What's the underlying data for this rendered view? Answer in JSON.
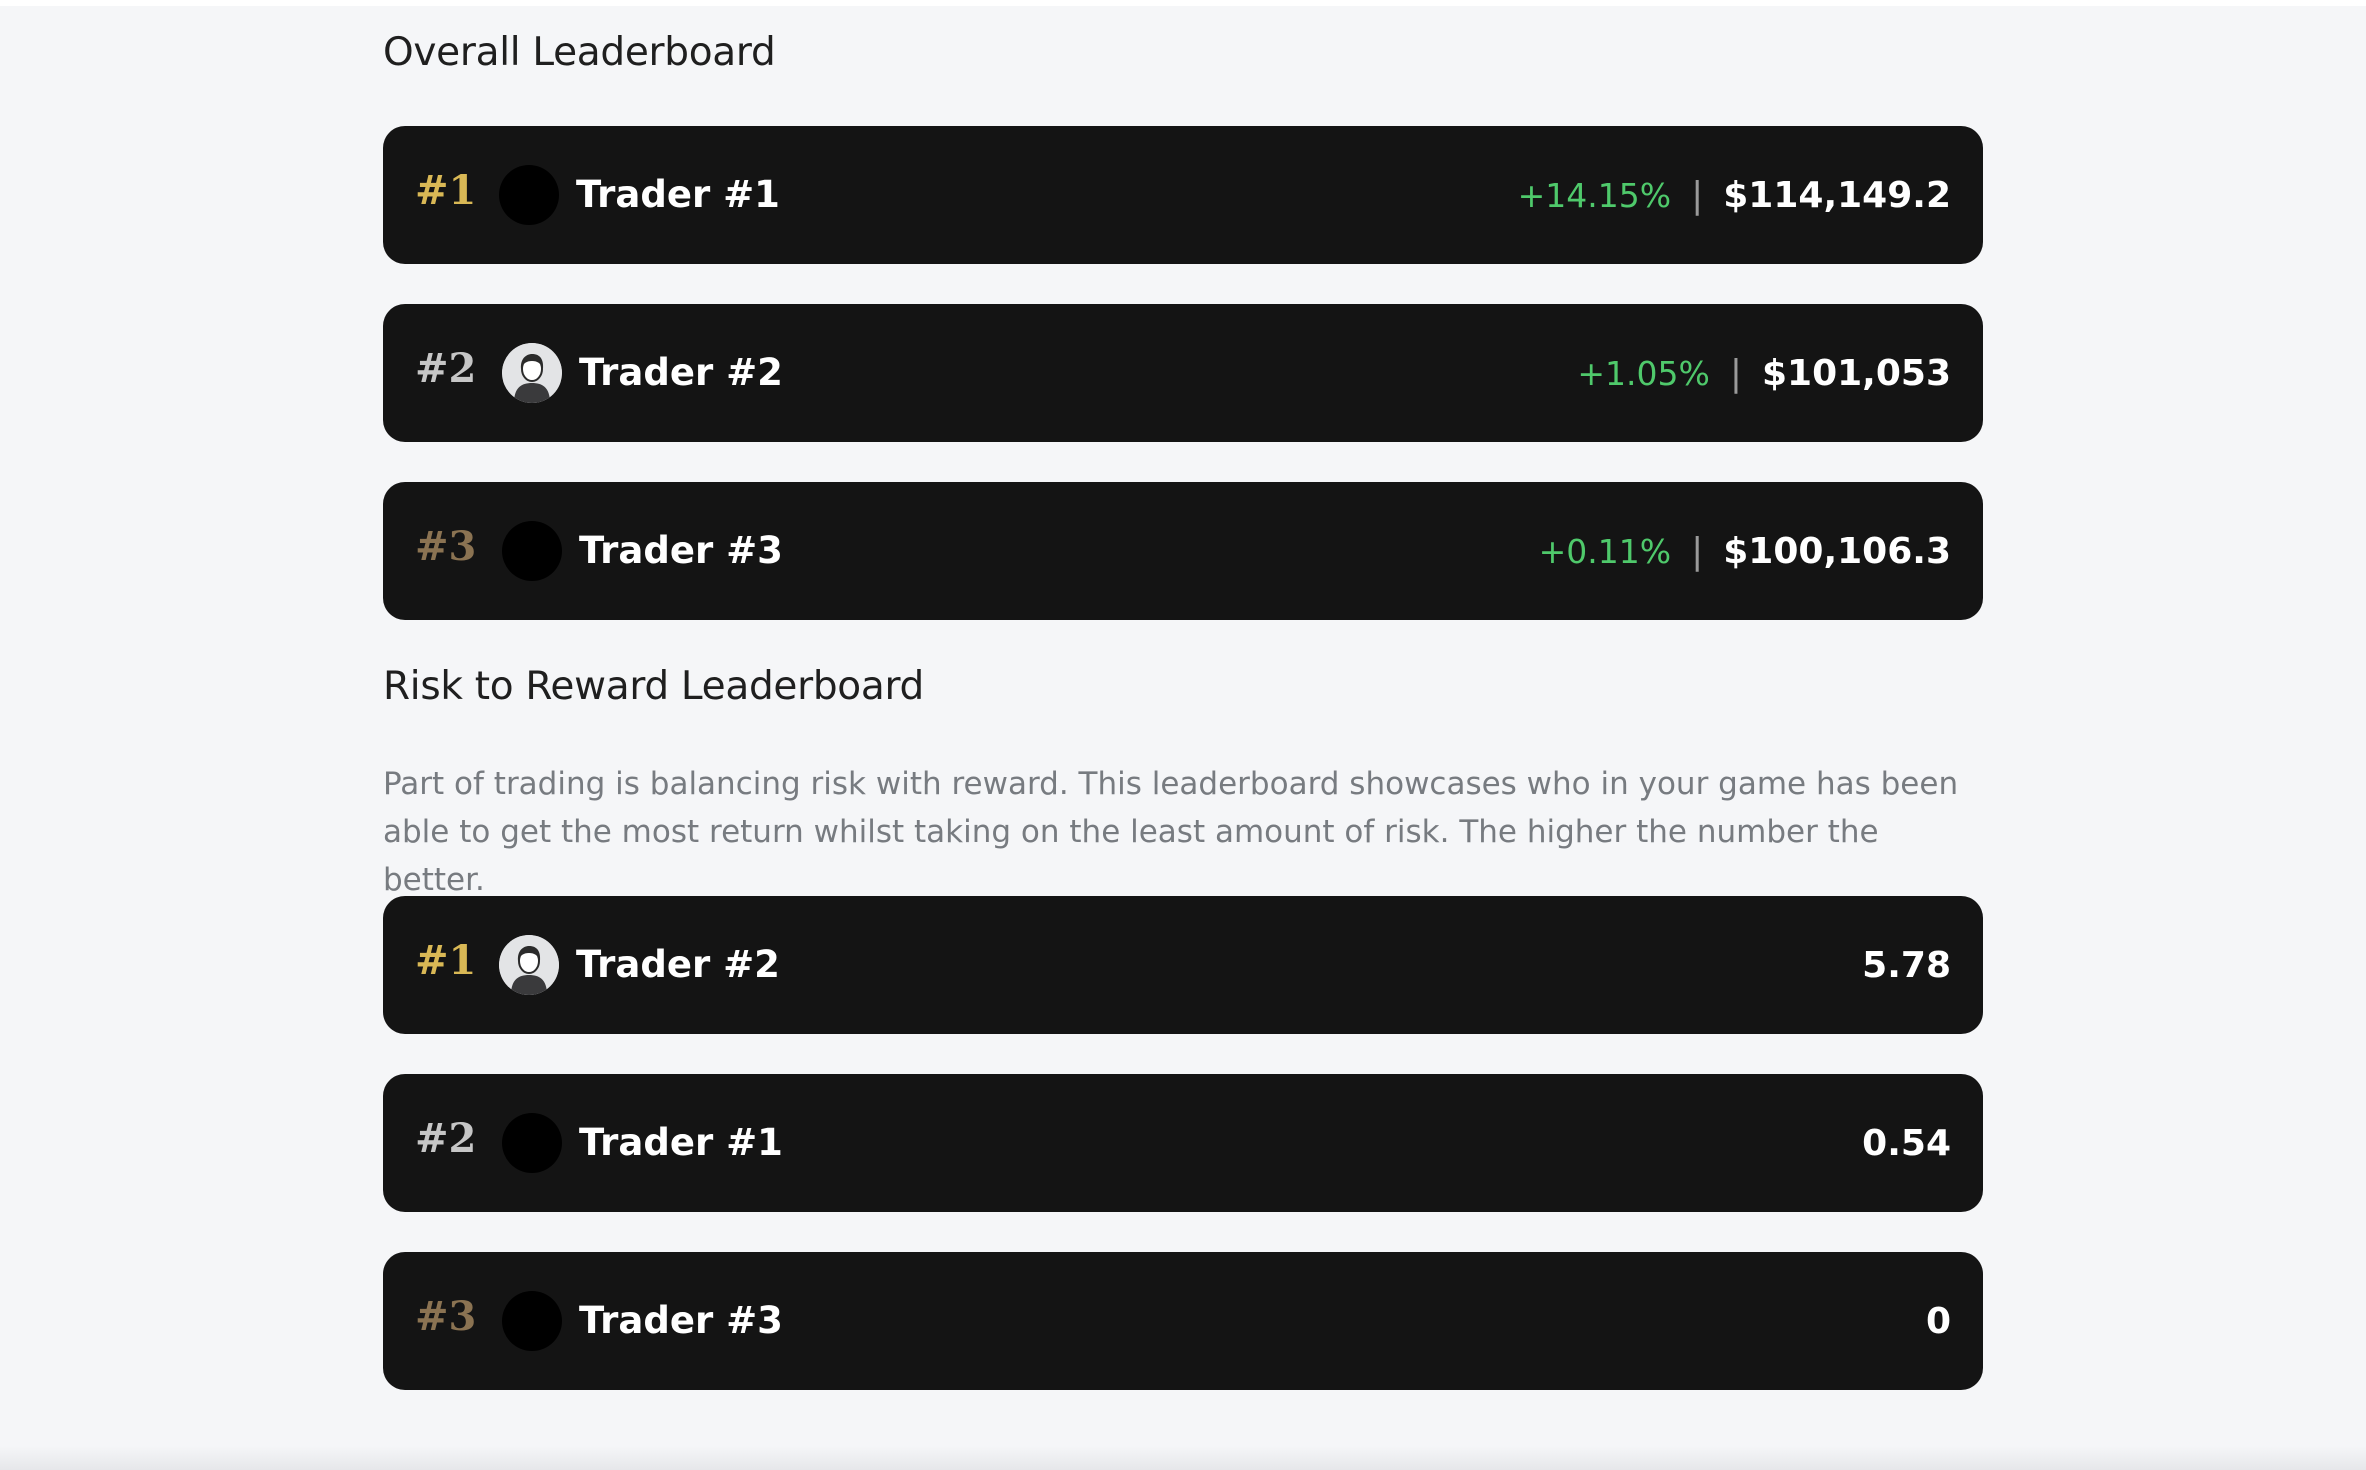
{
  "overall": {
    "title": "Overall Leaderboard",
    "rows": [
      {
        "rank": "#1",
        "name": "Trader #1",
        "change": "+14.15%",
        "separator": "|",
        "value": "$114,149.2",
        "avatar": "black-circle"
      },
      {
        "rank": "#2",
        "name": "Trader #2",
        "change": "+1.05%",
        "separator": "|",
        "value": "$101,053",
        "avatar": "user-photo-icon"
      },
      {
        "rank": "#3",
        "name": "Trader #3",
        "change": "+0.11%",
        "separator": "|",
        "value": "$100,106.3",
        "avatar": "black-circle"
      }
    ]
  },
  "risk_reward": {
    "title": "Risk to Reward Leaderboard",
    "description": "Part of trading is balancing risk with reward. This leaderboard showcases who in your game has been able to get the most return whilst taking on the least amount of risk. The higher the number the better.",
    "rows": [
      {
        "rank": "#1",
        "name": "Trader #2",
        "score": "5.78",
        "avatar": "user-photo-icon"
      },
      {
        "rank": "#2",
        "name": "Trader #1",
        "score": "0.54",
        "avatar": "black-circle"
      },
      {
        "rank": "#3",
        "name": "Trader #3",
        "score": "0",
        "avatar": "black-circle"
      }
    ]
  },
  "colors": {
    "row_bg": "#141414",
    "page_bg": "#f5f6f8",
    "gold": "#d9b855",
    "silver": "#c6c6c6",
    "bronze": "#8b7352",
    "positive": "#4fc96b"
  }
}
